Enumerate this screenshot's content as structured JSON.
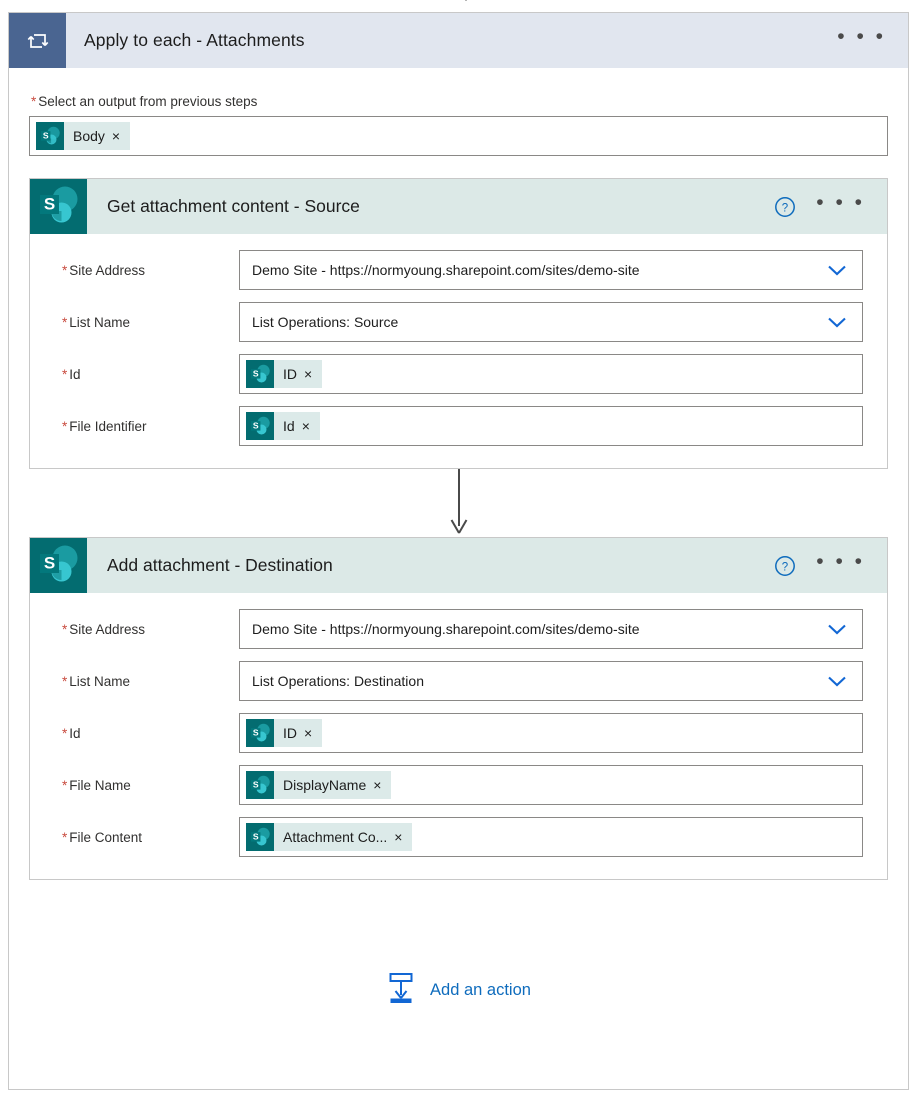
{
  "colors": {
    "loop_header_bg": "#e1e6ef",
    "loop_icon_bg": "#4a6591",
    "card_header_bg": "#dce9e7",
    "sharepoint_teal": "#036c70",
    "accent_blue": "#0f6cbd",
    "required_red": "#c94b3f",
    "border_gray": "#c8c8c8"
  },
  "loop": {
    "icon": "loop-repeat-icon",
    "title": "Apply to each - Attachments",
    "menu": "• • •",
    "foreach": {
      "label": "Select an output from previous steps",
      "required_marker": "*",
      "token": {
        "icon": "sharepoint-icon",
        "text": "Body",
        "remove": "×"
      }
    }
  },
  "cards": [
    {
      "icon": "sharepoint-icon",
      "title": "Get attachment content - Source",
      "help_icon": "help-circle-icon",
      "menu": "• • •",
      "fields": [
        {
          "label": "Site Address",
          "required_marker": "*",
          "type": "dropdown",
          "value": "Demo Site - https://normyoung.sharepoint.com/sites/demo-site",
          "chevron": "chevron-down-icon"
        },
        {
          "label": "List Name",
          "required_marker": "*",
          "type": "dropdown",
          "value": "List Operations: Source",
          "chevron": "chevron-down-icon"
        },
        {
          "label": "Id",
          "required_marker": "*",
          "type": "token",
          "token": {
            "icon": "sharepoint-icon",
            "text": "ID",
            "remove": "×"
          }
        },
        {
          "label": "File Identifier",
          "required_marker": "*",
          "type": "token",
          "token": {
            "icon": "sharepoint-icon",
            "text": "Id",
            "remove": "×"
          }
        }
      ]
    },
    {
      "icon": "sharepoint-icon",
      "title": "Add attachment - Destination",
      "help_icon": "help-circle-icon",
      "menu": "• • •",
      "fields": [
        {
          "label": "Site Address",
          "required_marker": "*",
          "type": "dropdown",
          "value": "Demo Site - https://normyoung.sharepoint.com/sites/demo-site",
          "chevron": "chevron-down-icon"
        },
        {
          "label": "List Name",
          "required_marker": "*",
          "type": "dropdown",
          "value": "List Operations: Destination",
          "chevron": "chevron-down-icon"
        },
        {
          "label": "Id",
          "required_marker": "*",
          "type": "token",
          "token": {
            "icon": "sharepoint-icon",
            "text": "ID",
            "remove": "×"
          }
        },
        {
          "label": "File Name",
          "required_marker": "*",
          "type": "token",
          "token": {
            "icon": "sharepoint-icon",
            "text": "DisplayName",
            "remove": "×"
          }
        },
        {
          "label": "File Content",
          "required_marker": "*",
          "type": "token",
          "token": {
            "icon": "sharepoint-icon",
            "text": "Attachment Co...",
            "remove": "×"
          }
        }
      ]
    }
  ],
  "add_action": {
    "icon": "add-action-icon",
    "label": "Add an action"
  }
}
